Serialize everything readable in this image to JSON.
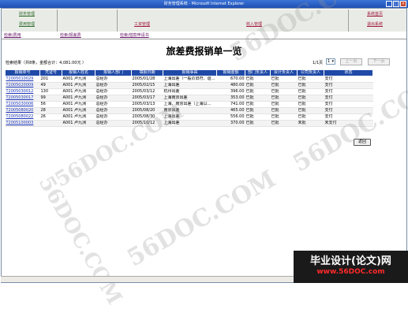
{
  "window": {
    "title": "财务管理系统 - Microsoft Internet Explorer"
  },
  "nav": {
    "row1": [
      {
        "label": "财务管理",
        "style": "green"
      },
      {
        "label": "系统首页",
        "style": "red"
      }
    ],
    "row2": [
      {
        "label": "费用管理",
        "style": "green"
      },
      {
        "label": "工资管理",
        "style": "red"
      },
      {
        "label": "收入管理",
        "style": "red"
      },
      {
        "label": "退出系统",
        "style": "red"
      }
    ],
    "sub": [
      "检索/费用",
      "检索/报差费",
      "检索/借款申请书"
    ]
  },
  "page_title": "旅差费报销单一览",
  "summary": "检索结果（共8条，金额合计：4,081.00元 ）",
  "pager": {
    "page_text": "1/1页",
    "select_value": "1",
    "prev_label": "上一页",
    "next_label": "下一页"
  },
  "table": {
    "headers": [
      "报销单号",
      "凭证号",
      "报销人姓名",
      "报销人部门",
      "填报日期",
      "报销事由",
      "报销金额",
      "部门负责人",
      "会计负责人",
      "公司负责人",
      "状态"
    ],
    "rows": [
      [
        "T2005010029",
        "201",
        "A001 卢九洲",
        "总经办",
        "2005/01/28",
        "上海出差（一般の旧符、谊…",
        "670.00",
        "已批",
        "已批",
        "已批",
        "支付"
      ],
      [
        "T2005020009",
        "49",
        "A001 卢九洲",
        "总经办",
        "2005/02/15",
        "上海出差",
        "480.00",
        "已批",
        "已批",
        "已批",
        "支付"
      ],
      [
        "T2005030012",
        "130",
        "A001 卢九洲",
        "总经办",
        "2005/03/12",
        "杭州出差",
        "396.00",
        "已批",
        "已批",
        "已批",
        "支付"
      ],
      [
        "T2005030017",
        "99",
        "A001 卢九洲",
        "总经办",
        "2005/03/17",
        "上海南京出差",
        "353.00",
        "已批",
        "已批",
        "已批",
        "支付"
      ],
      [
        "T2005030006",
        "56",
        "A001 卢九洲",
        "总经办",
        "2005/03/13",
        "上海、南京出差（上海以…",
        "741.00",
        "已批",
        "已批",
        "已批",
        "支付"
      ],
      [
        "T2005080020",
        "28",
        "A001 卢九洲",
        "总经办",
        "2005/08/20",
        "南京出差",
        "465.00",
        "已批",
        "已批",
        "已批",
        "支付"
      ],
      [
        "T2005080022",
        "26",
        "A001 卢九洲",
        "总经办",
        "2005/08/30",
        "上海出差",
        "556.00",
        "已批",
        "已批",
        "已批",
        "支付"
      ],
      [
        "T2005100003",
        "",
        "A001 卢九洲",
        "总经办",
        "2005/10/12",
        "上海出差",
        "370.00",
        "已批",
        "已批",
        "未批",
        "未支付"
      ]
    ]
  },
  "return_label": "返回",
  "watermark": "56DOC.COM",
  "brand": {
    "top": "毕业设计(论文)网",
    "bottom": "www.56DOC.com"
  },
  "colors": {
    "header_blue": "#1f4aa8",
    "link_blue": "#1a33b8",
    "nav_green": "#2e6b2e",
    "nav_red": "#a0143a"
  }
}
